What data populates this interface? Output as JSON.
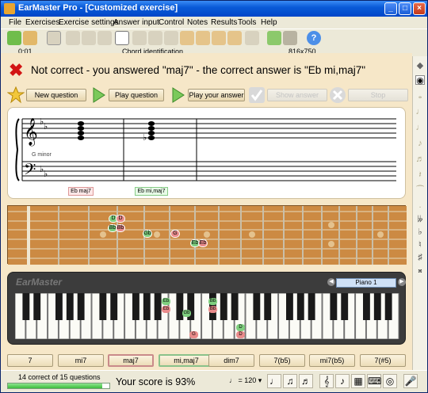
{
  "window": {
    "title": "EarMaster Pro - [Customized exercise]"
  },
  "menu": [
    "File",
    "Exercises",
    "Exercise settings",
    "Answer input",
    "Control",
    "Notes",
    "Results",
    "Tools",
    "Help"
  ],
  "toolbar": {
    "time": "0:01",
    "mode": "Chord identification",
    "resolution": "816x750"
  },
  "feedback": {
    "message": "Not correct - you answered \"maj7\" - the correct answer is \"Eb mi,maj7\""
  },
  "controls": {
    "new_question": "New question",
    "play_question": "Play question",
    "play_answer": "Play your answer",
    "show_answer": "Show answer",
    "stop": "Stop"
  },
  "staff": {
    "key_label": "G minor",
    "chord_label_wrong": "Eb maj7",
    "chord_label_correct": "Eb mi,maj7"
  },
  "fretboard": {
    "markers": [
      {
        "label": "D",
        "kind": "green"
      },
      {
        "label": "Bb",
        "kind": "green"
      },
      {
        "label": "Gb",
        "kind": "green"
      },
      {
        "label": "Eb",
        "kind": "green"
      },
      {
        "label": "D",
        "kind": "red"
      },
      {
        "label": "Bb",
        "kind": "red"
      },
      {
        "label": "G",
        "kind": "red"
      },
      {
        "label": "Eb",
        "kind": "red"
      }
    ]
  },
  "piano": {
    "brand": "EarMaster",
    "instrument": "Piano 1",
    "key_markers": [
      "Eb",
      "Eb",
      "Gb",
      "G",
      "Bb",
      "Bb",
      "D",
      "D"
    ]
  },
  "answers": [
    "7",
    "mi7",
    "maj7",
    "mi,maj7",
    "dim7",
    "7(b5)",
    "mi7(b5)",
    "7(#5)"
  ],
  "status": {
    "progress_text": "14 correct of 15 questions",
    "progress": 0.93,
    "score": "Your score is 93%",
    "tempo": "= 120"
  },
  "colors": {
    "accent": "#f6e7c8",
    "wrong": "#d21414",
    "correct_marker": "#7fcf7f",
    "wrong_marker": "#e98b8b"
  }
}
